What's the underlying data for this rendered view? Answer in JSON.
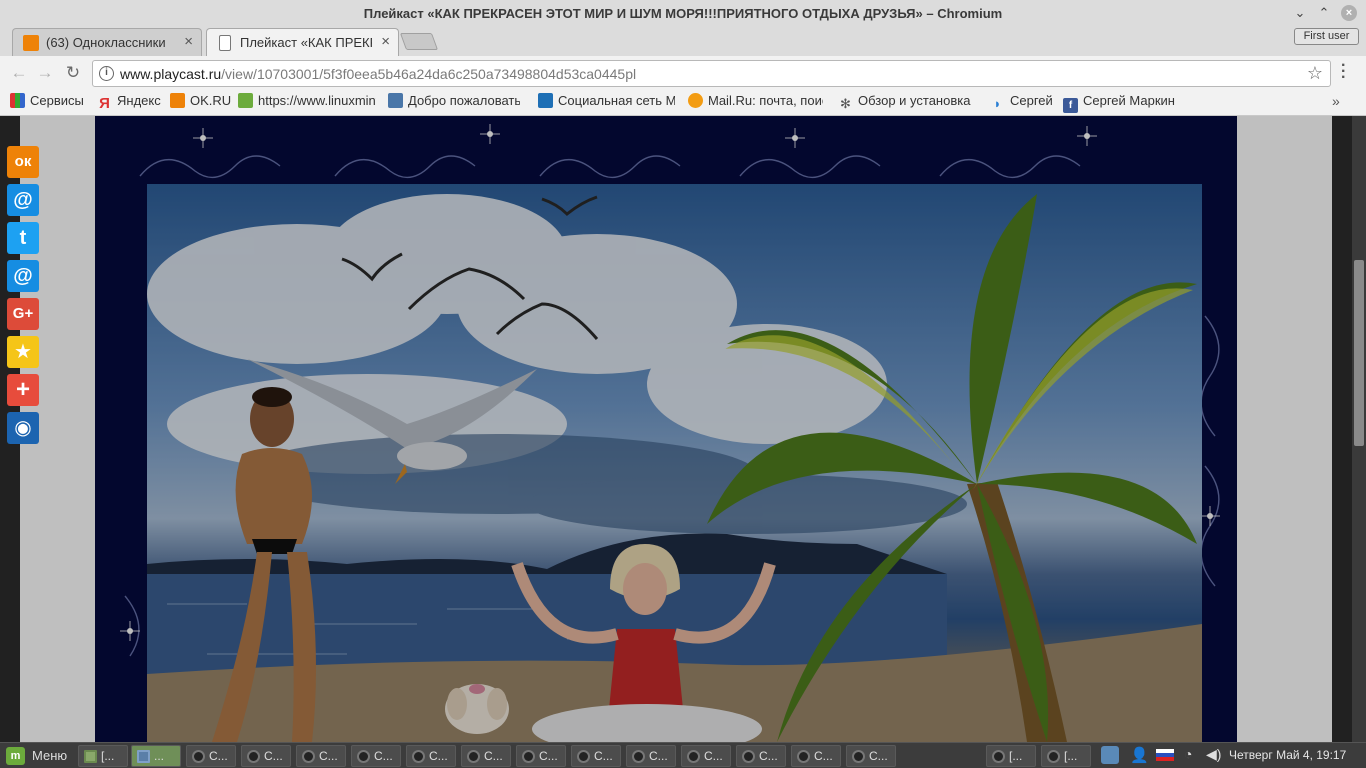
{
  "window": {
    "title": "Плейкаст «КАК ПРЕКРАСЕН ЭТОТ МИР И ШУМ МОРЯ!!!ПРИЯТНОГО ОТДЫХА ДРУЗЬЯ» – Chromium"
  },
  "user_button": "First user",
  "tabs": [
    {
      "label": "(63) Одноклассники",
      "close": "×",
      "icon": "ok-favicon",
      "active": false
    },
    {
      "label": "Плейкаст «КАК ПРЕКРАСЕН",
      "close": "×",
      "icon": "page-icon",
      "active": true
    }
  ],
  "toolbar": {
    "url_host": "www.playcast.ru",
    "url_path": "/view/10703001/5f3f0eea5b46a24da6c250a73498804d53ca0445pl",
    "back": "←",
    "forward": "→",
    "reload": "↻",
    "star": "☆",
    "info": "i"
  },
  "bookmarks": [
    {
      "label": "Сервисы",
      "icon": "apps-icon",
      "color": "#c0392b"
    },
    {
      "label": "Яндекс",
      "icon": "yandex-icon",
      "color": "#d33"
    },
    {
      "label": "OK.RU",
      "icon": "ok-icon",
      "color": "#ee8208"
    },
    {
      "label": "https://www.linuxmint",
      "icon": "mint-icon",
      "color": "#6cab3c"
    },
    {
      "label": "Добро пожаловать",
      "icon": "vk-icon",
      "color": "#4a76a8"
    },
    {
      "label": "Социальная сеть М",
      "icon": "mir-icon",
      "color": "#1e6fb5"
    },
    {
      "label": "Mail.Ru: почта, поис",
      "icon": "mailru-icon",
      "color": "#f39c12"
    },
    {
      "label": "Обзор и установка",
      "icon": "setup-icon",
      "color": "#555"
    },
    {
      "label": "Сергей",
      "icon": "person-icon",
      "color": "#2a7fd4"
    },
    {
      "label": "Сергей Маркин",
      "icon": "facebook-icon",
      "color": "#3b5998"
    }
  ],
  "bookmarks_more": "»",
  "social": [
    {
      "name": "odnoklassniki",
      "glyph": "ок",
      "color": "#ee8208"
    },
    {
      "name": "mailru",
      "glyph": "@",
      "color": "#168de2"
    },
    {
      "name": "twitter",
      "glyph": "t",
      "color": "#1da1f2"
    },
    {
      "name": "mailru-2",
      "glyph": "@",
      "color": "#168de2"
    },
    {
      "name": "google-plus",
      "glyph": "G+",
      "color": "#dd4b39"
    },
    {
      "name": "favorites",
      "glyph": "★",
      "color": "#f5c518"
    },
    {
      "name": "more",
      "glyph": "+",
      "color": "#e74c3c"
    },
    {
      "name": "livejournal",
      "glyph": "◉",
      "color": "#1c64b0"
    }
  ],
  "taskbar": {
    "menu": "Меню",
    "tasks": [
      {
        "label": "[...",
        "icon": "folder"
      },
      {
        "label": "...",
        "icon": "chrome",
        "active": true
      },
      {
        "label": "С...",
        "icon": "app"
      },
      {
        "label": "С...",
        "icon": "app"
      },
      {
        "label": "С...",
        "icon": "app"
      },
      {
        "label": "С...",
        "icon": "app"
      },
      {
        "label": "С...",
        "icon": "app"
      },
      {
        "label": "С...",
        "icon": "app"
      },
      {
        "label": "С...",
        "icon": "app"
      },
      {
        "label": "С...",
        "icon": "app"
      },
      {
        "label": "С...",
        "icon": "app"
      },
      {
        "label": "С...",
        "icon": "app"
      },
      {
        "label": "С...",
        "icon": "app"
      },
      {
        "label": "С...",
        "icon": "app"
      },
      {
        "label": "С...",
        "icon": "app"
      },
      {
        "label": "[...",
        "icon": "app"
      },
      {
        "label": "[...",
        "icon": "app"
      }
    ],
    "clock": "Четверг Май  4, 19:17"
  }
}
